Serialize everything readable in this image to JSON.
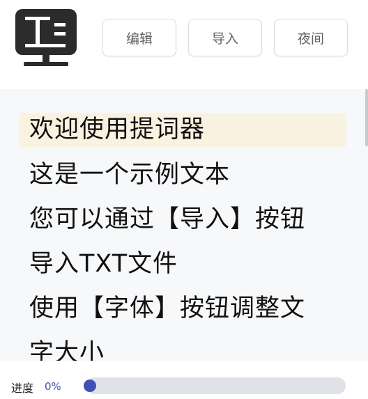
{
  "toolbar": {
    "edit_label": "编辑",
    "import_label": "导入",
    "night_label": "夜间"
  },
  "prompter": {
    "lines": [
      "欢迎使用提词器",
      "这是一个示例文本",
      "您可以通过【导入】按钮",
      "导入TXT文件",
      "使用【字体】按钮调整文",
      "字大小"
    ],
    "active_line": 0
  },
  "progress": {
    "label": "进度",
    "value_text": "0%",
    "value": 0
  },
  "colors": {
    "accent": "#3f51b5",
    "highlight": "#faf2e0",
    "logo": "#2b2b2b"
  },
  "icons": {
    "logo": "teleprompter-monitor-icon"
  }
}
